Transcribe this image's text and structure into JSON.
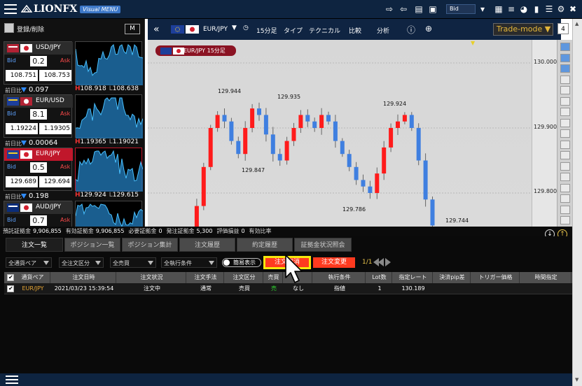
{
  "app": {
    "logo": "LIONFX",
    "visual_menu": "Visual MENU",
    "bid_select": "Bid"
  },
  "left_panel": {
    "add_delete": "登録/削除",
    "m_button": "M",
    "prev_label": "前日比",
    "bid_label": "Bid",
    "ask_label": "Ask",
    "pairs": [
      {
        "name": "USD/JPY",
        "spread": "0.2",
        "bid": "108.751",
        "ask": "108.753",
        "change": "0.097",
        "high": "108.918",
        "low": "108.638",
        "active": false
      },
      {
        "name": "EUR/USD",
        "spread": "8.1",
        "bid": "1.19224",
        "ask": "1.19305",
        "change": "0.00064",
        "high": "1.19365",
        "low": "1.19021",
        "active": false
      },
      {
        "name": "EUR/JPY",
        "spread": "0.5",
        "bid": "129.689",
        "ask": "129.694",
        "change": "0.198",
        "high": "129.924",
        "low": "129.615",
        "active": true
      },
      {
        "name": "AUD/JPY",
        "spread": "0.7",
        "bid": "",
        "ask": "",
        "change": "",
        "high": "",
        "low": "",
        "active": false
      }
    ]
  },
  "chart_toolbar": {
    "pair": "EUR/JPY",
    "timeframe": "15分足",
    "type": "タイプ",
    "technical": "テクニカル",
    "compare": "比較",
    "analysis": "分析",
    "trade_mode": "Trade-mode",
    "badge": "4"
  },
  "chart": {
    "tag": "EUR/JPY 15分足",
    "y_labels": [
      "130.000",
      "129.900",
      "129.800"
    ],
    "annotations": [
      "129.944",
      "129.935",
      "129.924",
      "129.847",
      "129.786",
      "129.744"
    ]
  },
  "balances": [
    {
      "label": "預託証拠金",
      "value": "9,906,855"
    },
    {
      "label": "有効証拠金",
      "value": "9,906,855"
    },
    {
      "label": "必要証拠金",
      "value": "0"
    },
    {
      "label": "発注証拠金",
      "value": "5,300"
    },
    {
      "label": "評価損益",
      "value": "0"
    },
    {
      "label": "有効比率",
      "value": ""
    }
  ],
  "tabs": [
    "注文一覧",
    "ポジション一覧",
    "ポジション集計",
    "注文履歴",
    "約定履歴",
    "証拠金状況照会"
  ],
  "filters": [
    "全通貨ペア",
    "全注文区分",
    "全売買",
    "全執行条件"
  ],
  "toggle_label": "簡易表示",
  "cancel_button": "注文取消",
  "modify_button": "注文変更",
  "page_indicator": "1/1",
  "table": {
    "headers": [
      "通貨ペア",
      "注文日時",
      "注文状況",
      "注文手法",
      "注文区分",
      "売買",
      "",
      "執行条件",
      "Lot数",
      "指定レート",
      "決済pip差",
      "トリガー価格",
      "時間指定"
    ],
    "row": {
      "pair": "EUR/JPY",
      "datetime": "2021/03/23 15:39:54",
      "status": "注文中",
      "method": "通常",
      "category": "売買",
      "side": "売",
      "extra": "なし",
      "condition": "指値",
      "lots": "1",
      "rate": "130.189"
    }
  }
}
